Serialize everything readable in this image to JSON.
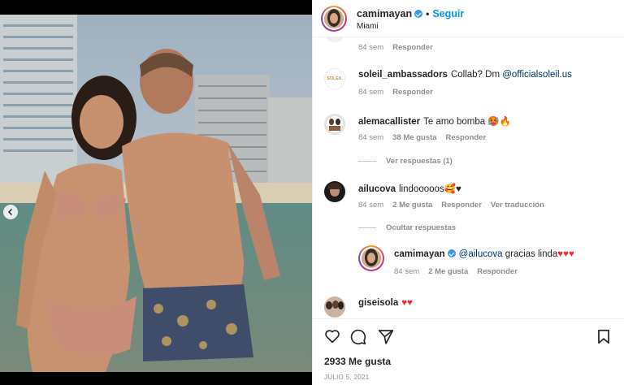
{
  "post": {
    "username": "camimayan",
    "follow_label": "Seguir",
    "location": "Miami",
    "likes_text": "2933 Me gusta",
    "date_text": "JULIO 5, 2021"
  },
  "comments": [
    {
      "meta": {
        "time": "84 sem",
        "reply": "Responder"
      }
    },
    {
      "user": "soleil_ambassadors",
      "text": "Collab? Dm ",
      "mention": "@officialsoleil.us",
      "avatar_label": "SOLEIL",
      "meta": {
        "time": "84 sem",
        "reply": "Responder"
      }
    },
    {
      "user": "alemacallister",
      "text": "Te amo bomba 🥵🔥",
      "meta": {
        "time": "84 sem",
        "likes": "38 Me gusta",
        "reply": "Responder"
      },
      "replies_toggle": "Ver respuestas (1)"
    },
    {
      "user": "ailucova",
      "text": "lindooooos🥰♥",
      "meta": {
        "time": "84 sem",
        "likes": "2 Me gusta",
        "reply": "Responder",
        "translate": "Ver traducción"
      },
      "replies_toggle": "Ocultar respuestas"
    },
    {
      "user": "camimayan",
      "mention": "@ailucova",
      "text": " gracias linda",
      "meta": {
        "time": "84 sem",
        "likes": "2 Me gusta",
        "reply": "Responder"
      }
    },
    {
      "user": "giseisola"
    }
  ],
  "icons": {
    "heart": "heart-icon",
    "comment": "comment-icon",
    "share": "share-icon",
    "save": "bookmark-icon",
    "verified": "verified-icon",
    "prev": "chevron-left-icon"
  },
  "colors": {
    "accent": "#0095f6",
    "verified": "#3897f0",
    "heart": "#ed2b2b"
  }
}
